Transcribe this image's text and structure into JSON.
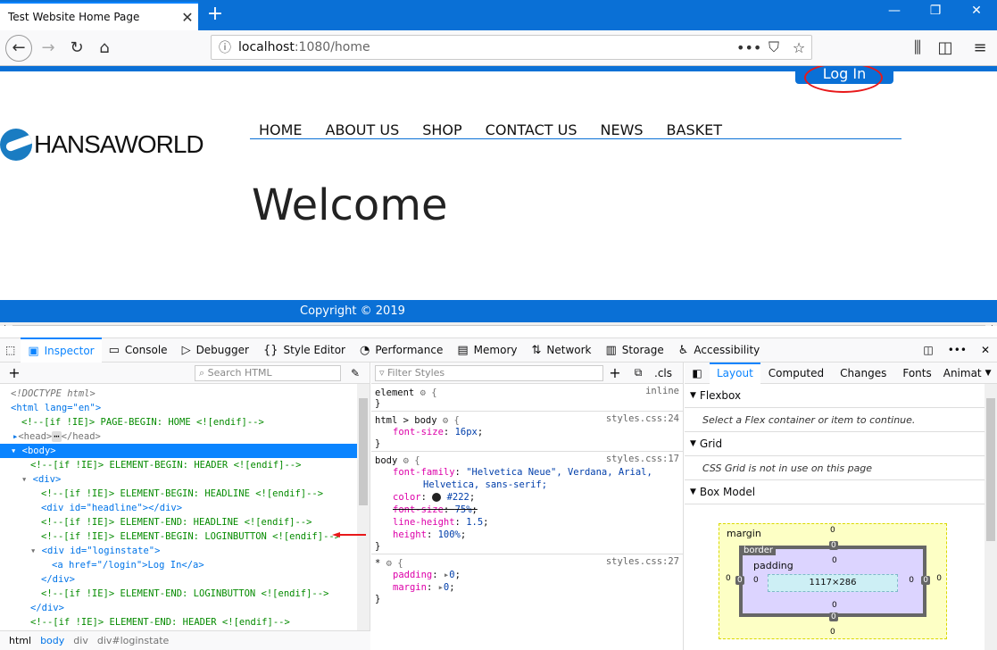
{
  "browser": {
    "tab_title": "Test Website Home Page",
    "url_host": "localhost",
    "url_path": ":1080/home"
  },
  "page": {
    "login_label": "Log In",
    "logo_text": "HANSAWORLD",
    "menu": [
      "HOME",
      "ABOUT US",
      "SHOP",
      "CONTACT US",
      "NEWS",
      "BASKET"
    ],
    "heading": "Welcome",
    "footer": "Copyright © 2019"
  },
  "devtools": {
    "tabs": [
      "Inspector",
      "Console",
      "Debugger",
      "Style Editor",
      "Performance",
      "Memory",
      "Network",
      "Storage",
      "Accessibility"
    ],
    "search_html_placeholder": "Search HTML",
    "filter_styles_placeholder": "Filter Styles",
    "cls_label": ".cls",
    "right_tabs": [
      "Layout",
      "Computed",
      "Changes",
      "Fonts",
      "Animat"
    ],
    "flexbox_title": "Flexbox",
    "flexbox_note": "Select a Flex container or item to continue.",
    "grid_title": "Grid",
    "grid_note": "CSS Grid is not in use on this page",
    "boxmodel_title": "Box Model",
    "box": {
      "margin_label": "margin",
      "border_label": "border",
      "padding_label": "padding",
      "size": "1117×286",
      "zero": "0"
    },
    "breadcrumbs": [
      "html",
      "body",
      "div",
      "div#loginstate"
    ],
    "html_lines": [
      "<!DOCTYPE html>",
      "<html lang=\"en\">",
      "<!--[if !IE]> PAGE-BEGIN: HOME <![endif]-->",
      "<head>",
      "</head>",
      "<body>",
      "<!--[if !IE]> ELEMENT-BEGIN: HEADER <![endif]-->",
      "<div>",
      "<!--[if !IE]> ELEMENT-BEGIN: HEADLINE <![endif]-->",
      "<div id=\"headline\"></div>",
      "<!--[if !IE]> ELEMENT-END: HEADLINE <![endif]-->",
      "<!--[if !IE]> ELEMENT-BEGIN: LOGINBUTTON <![endif]-->",
      "<div id=\"loginstate\">",
      "<a href=\"/login\">Log In</a>",
      "</div>",
      "<!--[if !IE]> ELEMENT-END: LOGINBUTTON <![endif]-->",
      "</div>",
      "<!--[if !IE]> ELEMENT-END: HEADER <![endif]-->"
    ],
    "rules": {
      "element_sel": "element",
      "element_src": "inline",
      "html_body_sel": "html > body",
      "html_body_src": "styles.css:24",
      "body_sel": "body",
      "body_src": "styles.css:17",
      "star_sel": "*",
      "star_src": "styles.css:27",
      "font_size_16": "16px",
      "font_family_val1": "\"Helvetica Neue\", Verdana, Arial,",
      "font_family_val2": "Helvetica, sans-serif;",
      "color_val": "#222",
      "font_size_75": "75%",
      "line_height_val": "1.5",
      "height_val": "100%",
      "padding_val": "0",
      "margin_val": "0"
    }
  }
}
